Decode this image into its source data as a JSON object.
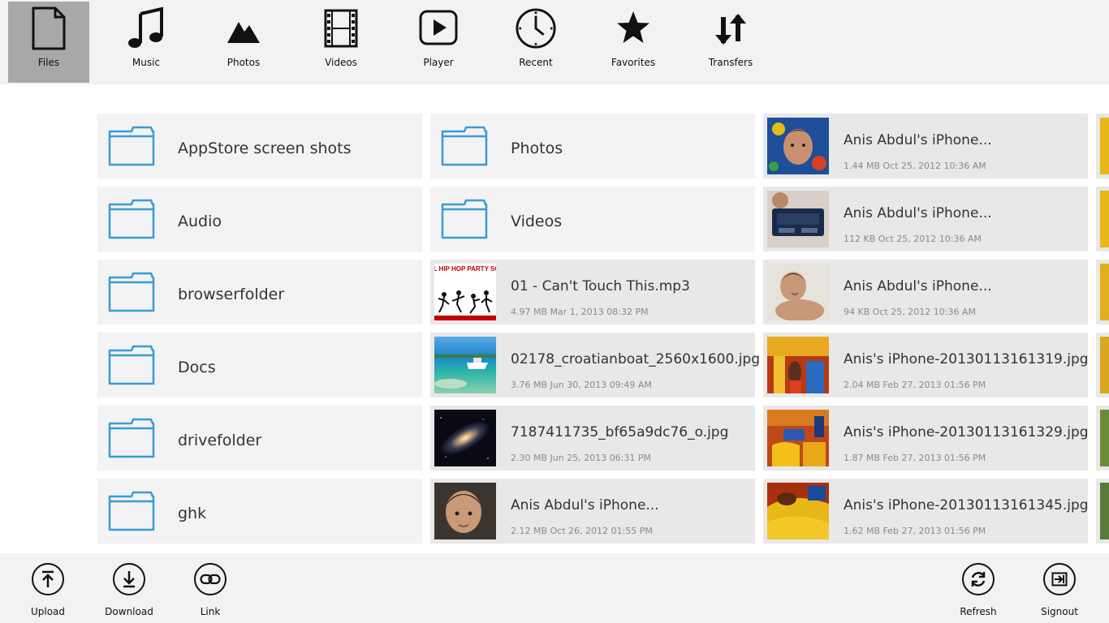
{
  "nav": {
    "items": [
      {
        "label": "Files",
        "icon": "file-icon",
        "active": true
      },
      {
        "label": "Music",
        "icon": "music-note-icon"
      },
      {
        "label": "Photos",
        "icon": "mountains-icon"
      },
      {
        "label": "Videos",
        "icon": "film-strip-icon"
      },
      {
        "label": "Player",
        "icon": "play-icon"
      },
      {
        "label": "Recent",
        "icon": "clock-icon"
      },
      {
        "label": "Favorites",
        "icon": "star-icon"
      },
      {
        "label": "Transfers",
        "icon": "transfer-arrows-icon"
      }
    ]
  },
  "folders_col1": [
    {
      "name": "AppStore screen shots"
    },
    {
      "name": "Audio"
    },
    {
      "name": "browserfolder"
    },
    {
      "name": "Docs"
    },
    {
      "name": "drivefolder"
    },
    {
      "name": "ghk"
    }
  ],
  "col2": {
    "folders": [
      {
        "name": "Photos"
      },
      {
        "name": "Videos"
      }
    ],
    "files": [
      {
        "name": "01 - Can't Touch This.mp3",
        "meta": "4.97 MB Mar 1, 2013 08:32 PM",
        "thumb_text": "OLD SCHOOL HIP HOP PARTY SOUNDTRACK"
      },
      {
        "name": "02178_croatianboat_2560x1600.jpg",
        "meta": "3.76 MB Jun 30, 2013 09:49 AM"
      },
      {
        "name": "7187411735_bf65a9dc76_o.jpg",
        "meta": "2.30 MB Jun 25, 2013 06:31 PM"
      },
      {
        "name": "Anis Abdul's iPhone...",
        "meta": "2.12 MB Oct 26, 2012 01:55 PM"
      }
    ]
  },
  "col3": {
    "files": [
      {
        "name": "Anis Abdul's iPhone...",
        "meta": "1.44 MB Oct 25, 2012 10:36 AM"
      },
      {
        "name": "Anis Abdul's iPhone...",
        "meta": "112 KB Oct 25, 2012 10:36 AM"
      },
      {
        "name": "Anis Abdul's iPhone...",
        "meta": "94 KB Oct 25, 2012 10:36 AM"
      },
      {
        "name": "Anis's iPhone-20130113161319.jpg",
        "meta": "2.04 MB Feb 27, 2013 01:56 PM"
      },
      {
        "name": "Anis's iPhone-20130113161329.jpg",
        "meta": "1.87 MB Feb 27, 2013 01:56 PM"
      },
      {
        "name": "Anis's iPhone-20130113161345.jpg",
        "meta": "1.62 MB Feb 27, 2013 01:56 PM"
      }
    ]
  },
  "appbar": {
    "upload_label": "Upload",
    "download_label": "Download",
    "link_label": "Link",
    "refresh_label": "Refresh",
    "signout_label": "Signout"
  },
  "colors": {
    "folder_stroke": "#3a9bd6",
    "active_nav": "#a8a8a8",
    "tile_folder": "#f3f3f3",
    "tile_file": "#e8e8e8"
  }
}
